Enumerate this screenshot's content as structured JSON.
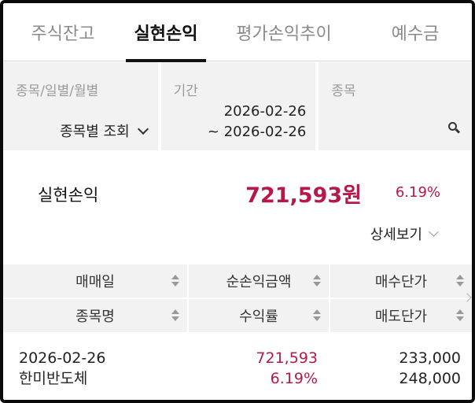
{
  "tabs": [
    {
      "label": "주식잔고",
      "active": false
    },
    {
      "label": "실현손익",
      "active": true
    },
    {
      "label": "평가손익추이",
      "active": false
    },
    {
      "label": "예수금",
      "active": false
    }
  ],
  "filters": {
    "mode": {
      "label": "종목/일별/월별",
      "value": "종목별 조회"
    },
    "period": {
      "label": "기간",
      "from": "2026-02-26",
      "to": "~ 2026-02-26"
    },
    "stock": {
      "label": "종목",
      "value": ""
    }
  },
  "summary": {
    "label": "실현손익",
    "amount": "721,593원",
    "rate": "6.19%",
    "detail_link": "상세보기"
  },
  "table": {
    "header_row1": [
      "매매일",
      "순손익금액",
      "매수단가"
    ],
    "header_row2": [
      "종목명",
      "수익률",
      "매도단가"
    ],
    "rows": [
      {
        "date": "2026-02-26",
        "name": "한미반도체",
        "net_profit": "721,593",
        "rate": "6.19%",
        "buy_price": "233,000",
        "sell_price": "248,000"
      }
    ]
  },
  "colors": {
    "accent": "#b8174a",
    "header_bg": "#f2f2f2",
    "muted_text": "#9b9b9b"
  }
}
